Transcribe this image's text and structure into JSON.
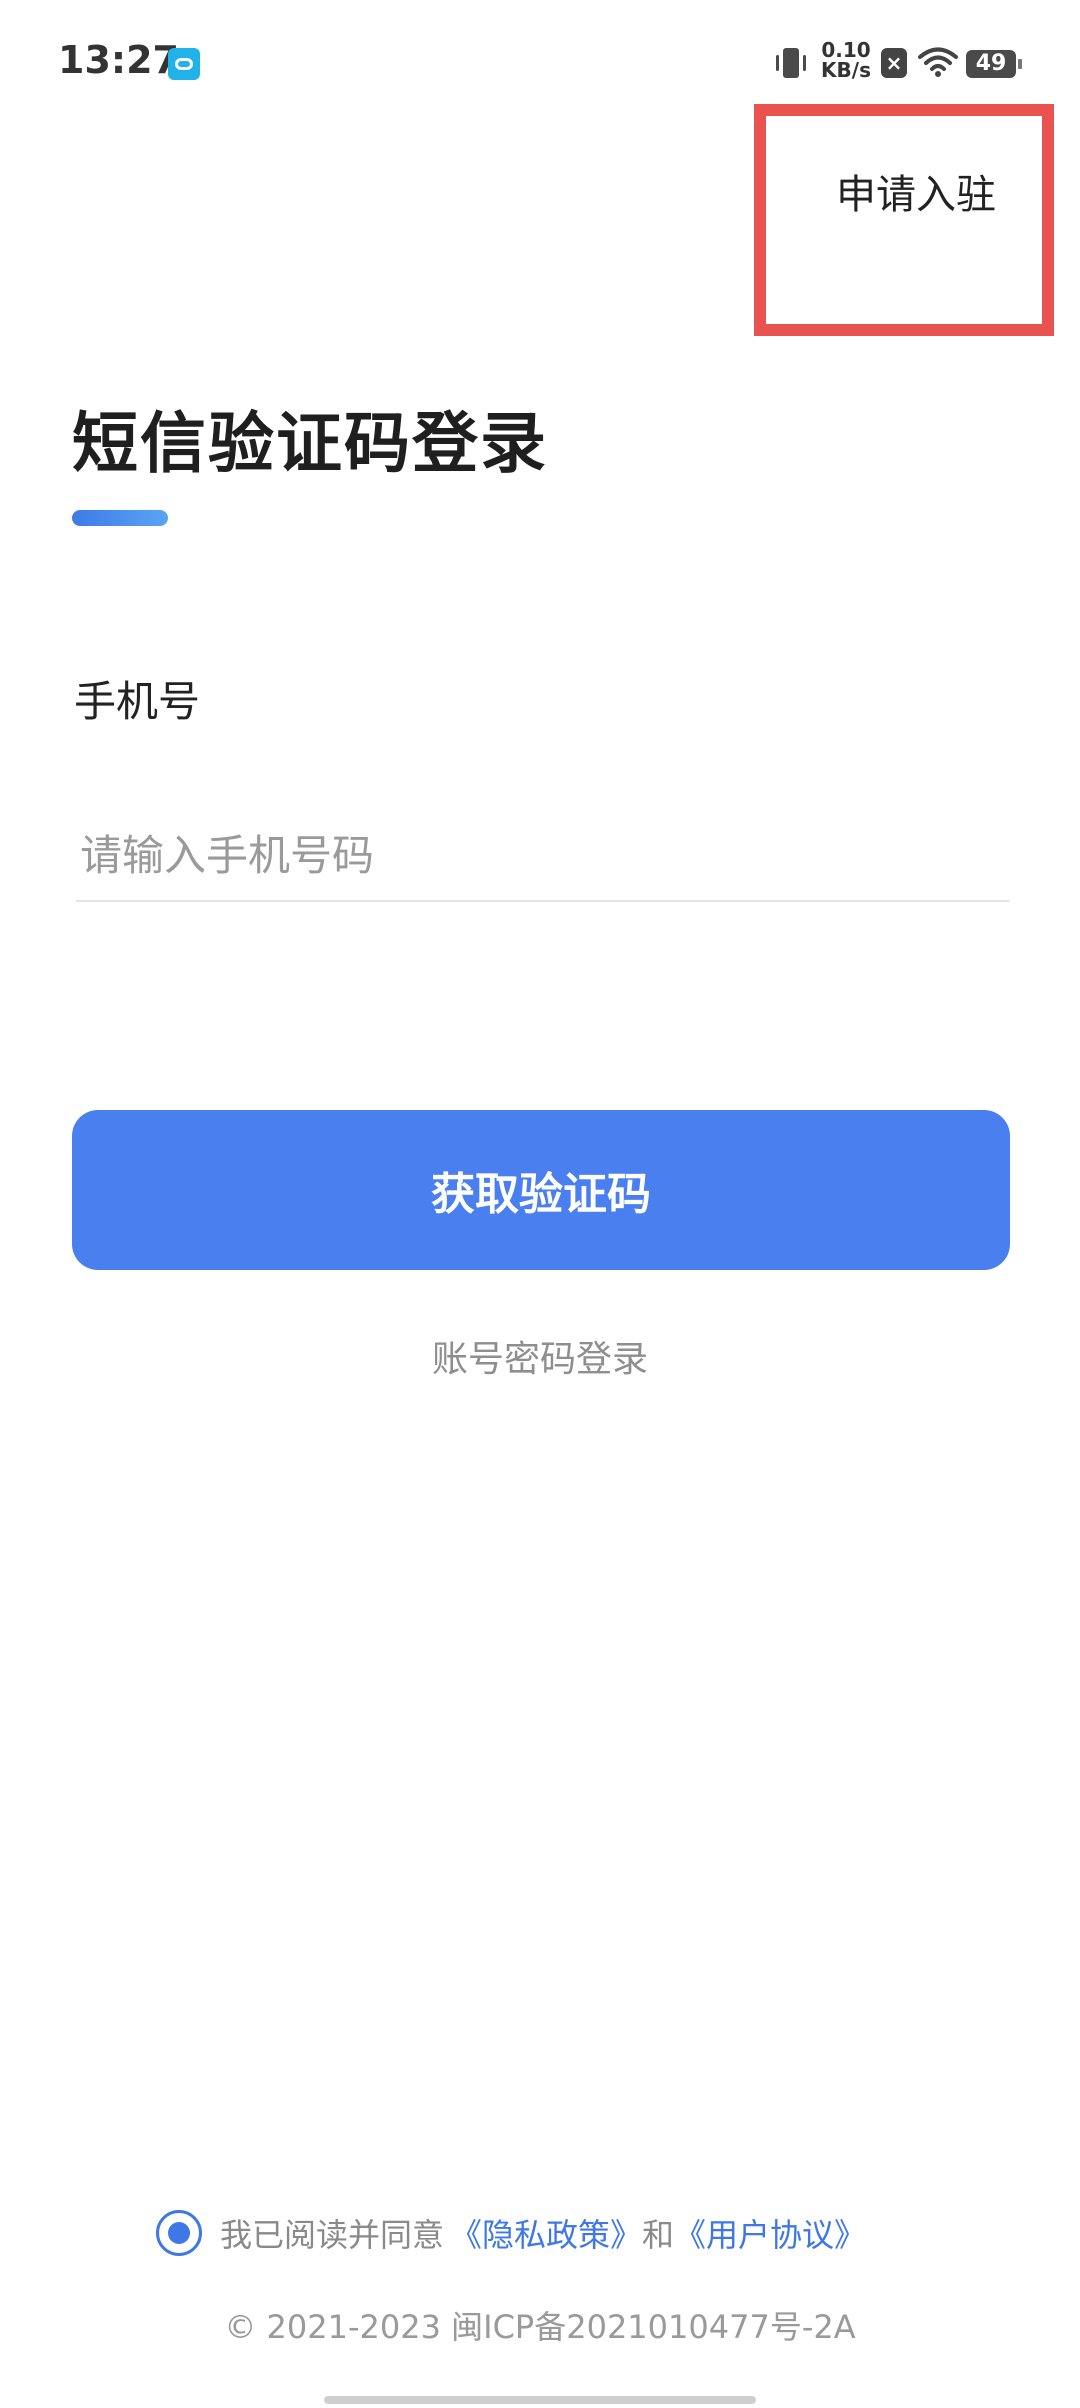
{
  "status_bar": {
    "time": "13:27",
    "net_speed_value": "0.10",
    "net_speed_unit": "KB/s",
    "notification_x": "×",
    "battery": "49"
  },
  "header": {
    "apply_label": "申请入驻"
  },
  "login": {
    "title": "短信验证码登录",
    "phone_label": "手机号",
    "phone_placeholder": "请输入手机号码",
    "phone_value": "",
    "submit_label": "获取验证码",
    "alt_login_label": "账号密码登录"
  },
  "agreement": {
    "text": "我已阅读并同意",
    "privacy_link": "《隐私政策》",
    "conjunction": "和",
    "terms_link": "《用户协议》"
  },
  "footer": {
    "icp": "© 2021-2023 闽ICP备2021010477号-2A"
  },
  "colors": {
    "accent": "#4a7ff0",
    "highlight_border": "#e8524f",
    "link": "#3f78e6"
  }
}
